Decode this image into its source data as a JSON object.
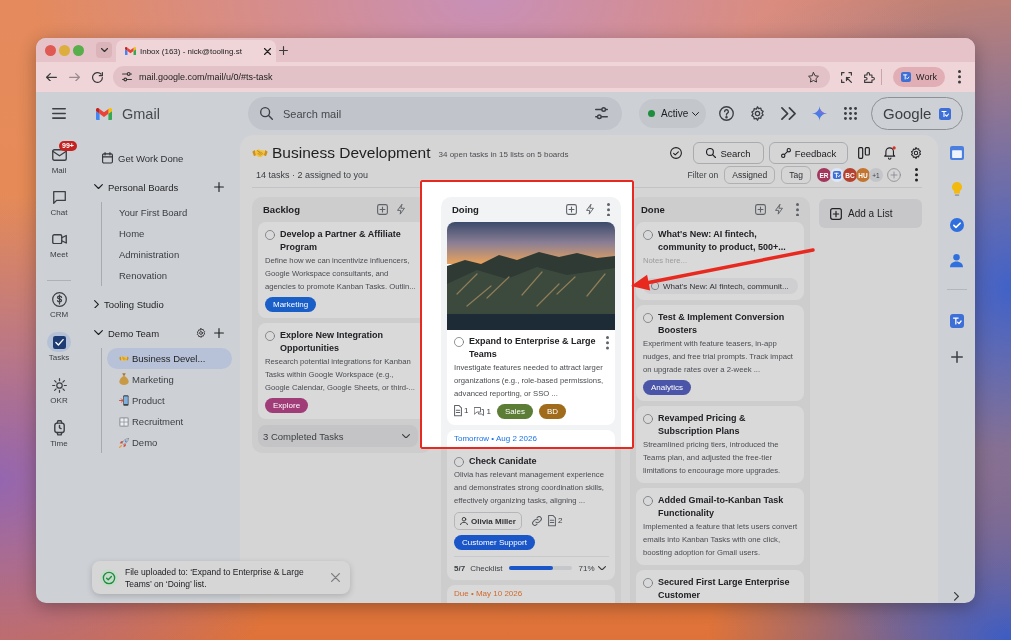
{
  "browser": {
    "tabs": [
      {
        "title": "Inbox (163) - nick@tooling.st",
        "selected": true
      }
    ],
    "url": "mail.google.com/mail/u/0/#ts-task",
    "profile": "Work"
  },
  "header": {
    "app_name": "Gmail",
    "search": {
      "placeholder": "Search mail"
    },
    "status": {
      "label": "Active",
      "color": "#1e8e3e"
    },
    "account": "Google"
  },
  "rail": {
    "apps": [
      {
        "kind": "mail",
        "label": "Mail",
        "badge": "99+",
        "selected": false
      },
      {
        "kind": "chat",
        "label": "Chat",
        "selected": false
      },
      {
        "kind": "meet",
        "label": "Meet",
        "selected": false
      }
    ],
    "addons": [
      {
        "kind": "crm",
        "label": "CRM",
        "selected": false
      },
      {
        "kind": "tasks",
        "label": "Tasks",
        "selected": true
      },
      {
        "kind": "okr",
        "label": "OKR",
        "selected": false
      },
      {
        "kind": "time",
        "label": "Time",
        "selected": false
      }
    ]
  },
  "sidebar": {
    "top_item": "Get Work Done",
    "groups": [
      {
        "label": "Personal Boards",
        "expanded": true,
        "add_button": true,
        "settings_button": false,
        "children": [
          {
            "label": "Your First Board",
            "selected": false
          },
          {
            "label": "Home",
            "selected": false
          },
          {
            "label": "Administration",
            "selected": false
          },
          {
            "label": "Renovation",
            "selected": false
          }
        ]
      },
      {
        "label": "Tooling Studio",
        "expanded": false,
        "add_button": false,
        "settings_button": false
      },
      {
        "label": "Demo Team",
        "expanded": true,
        "add_button": true,
        "settings_button": true,
        "children": [
          {
            "kind": "handshake",
            "label": "Business Devel...",
            "selected": true
          },
          {
            "kind": "money-bag",
            "label": "Marketing",
            "selected": false
          },
          {
            "kind": "phone",
            "label": "Product",
            "selected": false
          },
          {
            "kind": "grid",
            "label": "Recruitment",
            "selected": false
          },
          {
            "kind": "rocket",
            "label": "Demo",
            "selected": false
          }
        ]
      }
    ]
  },
  "board": {
    "title": "Business Development",
    "summary": "34 open tasks in 15 lists on 5 boards",
    "subtitle": "14 tasks · 2 assigned to you",
    "search_button": "Search",
    "feedback_button": "Feedback",
    "notifications_unread": true,
    "filter_label": "Filter on",
    "filter_chips": [
      "Assigned",
      "Tag"
    ],
    "members": [
      {
        "kind": "initials",
        "initials": "ER",
        "color": "#a3365c"
      },
      {
        "kind": "logo"
      },
      {
        "kind": "initials",
        "initials": "BC",
        "color": "#b5412f"
      },
      {
        "kind": "initials",
        "initials": "HU",
        "color": "#c27530"
      }
    ],
    "more_members": "+1",
    "lists": [
      {
        "title": "Backlog",
        "highlighted": false,
        "menu_button": false,
        "cards": [
          {
            "checked": false,
            "title": "Develop a Partner & Affiliate Program",
            "description": "Define how we can incentivize influencers, Google Workspace consultants, and agencies to promote Kanban Tasks. Outlin...",
            "tags": [
              {
                "label": "Marketing",
                "color": "#1a5fc7"
              }
            ]
          },
          {
            "checked": false,
            "title": "Explore New Integration Opportunities",
            "description": "Research potential integrations for Kanban Tasks within Google Workspace (e.g., Google Calendar, Google Sheets, or third-...",
            "tags": [
              {
                "label": "Explore",
                "color": "#a03c78"
              }
            ]
          }
        ],
        "footer": "3 Completed Tasks"
      },
      {
        "title": "Doing",
        "highlighted": true,
        "menu_button": true,
        "cards": [
          {
            "cover_photo": true,
            "checked": false,
            "menu_button": true,
            "title": "Expand to Enterprise & Large Teams",
            "description": "Investigate features needed to attract larger organizations (e.g., role-based permissions, advanced reporting, or SSO ...",
            "attachments": "1",
            "comments": "1",
            "tags": [
              {
                "label": "Sales",
                "color": "#5b7d36"
              },
              {
                "label": "BD",
                "color": "#a06c1c"
              }
            ]
          },
          {
            "date": {
              "kind": "upcoming",
              "label": "Tomorrow • Aug 2 2026"
            },
            "checked": false,
            "title": "Check Canidate",
            "description": "Olivia has relevant management experience and demonstrates strong coordination skills, effectively organizing tasks, aligning ...",
            "assignee": "Olivia Miller",
            "link": true,
            "attachments": "2",
            "tags": [
              {
                "label": "Customer Support",
                "color": "#1a56c8"
              }
            ],
            "checklist": {
              "count": "5/7",
              "label": "Checklist",
              "level": 0.71,
              "reading": "71%",
              "expanded": false
            }
          },
          {
            "date": {
              "kind": "due",
              "label": "Due • May 10 2026"
            }
          }
        ]
      },
      {
        "title": "Done",
        "highlighted": false,
        "menu_button": true,
        "cards": [
          {
            "checked": false,
            "title": "What's New: AI fintech, community to product, 500+...",
            "notes": {
              "placeholder": "Notes here..."
            },
            "subtask": "What's New: AI fintech, communit..."
          },
          {
            "checked": false,
            "title": "Test & Implement Conversion Boosters",
            "description": "Experiment with feature teasers, in-app nudges, and free trial prompts. Track impact on upgrade rates over a 2-week ...",
            "tags": [
              {
                "label": "Analytics",
                "color": "#4c56a8"
              }
            ]
          },
          {
            "checked": false,
            "title": "Revamped Pricing & Subscription Plans",
            "description": "Streamlined pricing tiers, introduced the Teams plan, and adjusted the free-tier limitations to encourage more upgrades."
          },
          {
            "checked": false,
            "title": "Added Gmail-to-Kanban Task Functionality",
            "description": "Implemented a feature that lets users convert emails into Kanban Tasks with one click, boosting adoption for Gmail users."
          },
          {
            "checked": false,
            "title": "Secured First Large Enterprise Customer"
          }
        ]
      }
    ],
    "add_list": "Add a List"
  },
  "toast": {
    "message": "File uploaded to: ‘Expand to Enterprise & Large Teams’ on ‘Doing’ list."
  },
  "annotation": {
    "arrow": true
  }
}
